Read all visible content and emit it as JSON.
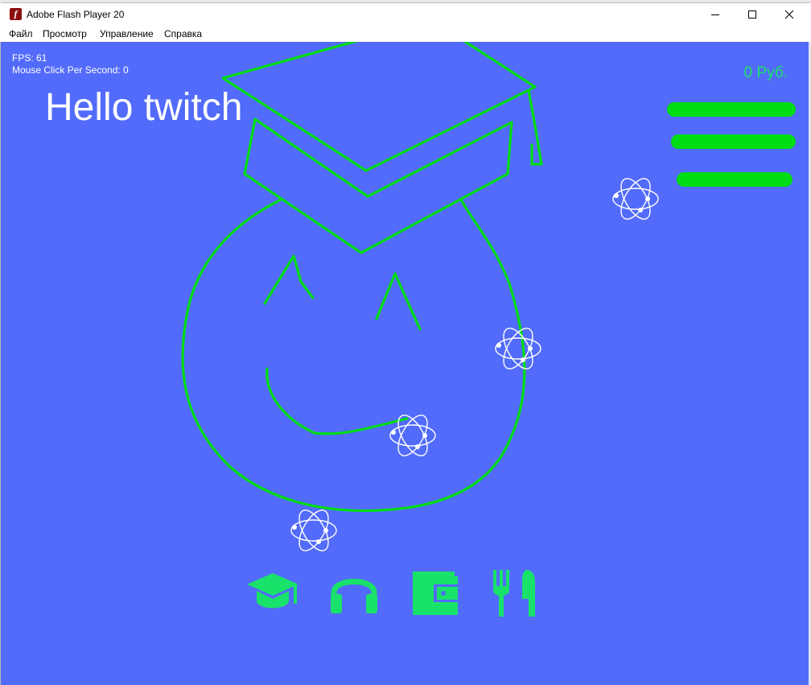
{
  "window": {
    "title": "Adobe Flash Player 20",
    "app_icon_glyph": "f",
    "controls": {
      "minimize": "minimize-icon",
      "maximize": "maximize-icon",
      "close": "close-icon"
    }
  },
  "menu": {
    "items": [
      {
        "label": "Файл"
      },
      {
        "label": "Просмотр"
      },
      {
        "label": "Управление"
      },
      {
        "label": "Справка"
      }
    ]
  },
  "stage": {
    "background": "#526bfa",
    "fps_text": "FPS: 61",
    "mouse_clicks_text": "Mouse Click Per Second: 0",
    "greeting": "Hello twitch",
    "money_text": "0 Руб.",
    "drawing_color": "#00dd13",
    "atoms": [
      {
        "icon": "atom-icon"
      },
      {
        "icon": "atom-icon"
      },
      {
        "icon": "atom-icon"
      },
      {
        "icon": "atom-icon"
      }
    ],
    "bottom_icons": [
      {
        "icon": "graduation-cap-icon"
      },
      {
        "icon": "headphones-icon"
      },
      {
        "icon": "wallet-icon"
      },
      {
        "icon": "fork-knife-icon"
      }
    ],
    "icon_color": "#19e26a"
  }
}
